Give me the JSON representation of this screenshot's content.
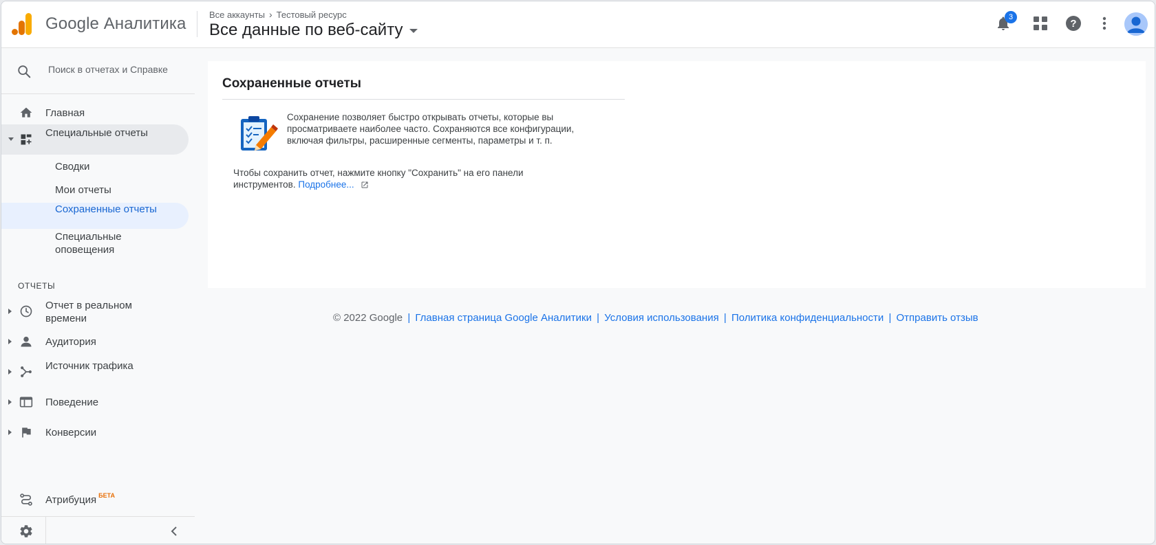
{
  "header": {
    "product_name": "Google Аналитика",
    "breadcrumb": {
      "account": "Все аккаунты",
      "property": "Тестовый ресурс"
    },
    "view_name": "Все данные по веб-сайту",
    "notifications_count": "3",
    "icons": [
      "notifications-icon",
      "apps-grid-icon",
      "help-icon",
      "more-vert-icon",
      "account-avatar-icon"
    ]
  },
  "sidebar": {
    "search_placeholder": "Поиск в отчетах и Справке",
    "items": {
      "home": "Главная",
      "custom_reports": "Специальные отчеты",
      "dashboards": "Сводки",
      "my_reports": "Мои отчеты",
      "saved_reports": "Сохраненные отчеты",
      "custom_alerts": "Специальные оповещения"
    },
    "reports_section_label": "ОТЧЕТЫ",
    "reports": {
      "realtime": "Отчет в реальном времени",
      "audience": "Аудитория",
      "acquisition": "Источник трафика",
      "behavior": "Поведение",
      "conversions": "Конверсии"
    },
    "attribution": "Атрибуция",
    "attribution_badge": "БЕТА"
  },
  "main": {
    "title": "Сохраненные отчеты",
    "description": "Сохранение позволяет быстро открывать отчеты, которые вы просматриваете наиболее часто. Сохраняются все конфигурации, включая фильтры, расширенные сегменты, параметры и т. п.",
    "hint": "Чтобы сохранить отчет, нажмите кнопку \"Сохранить\" на его панели инструментов.",
    "learn_more": "Подробнее..."
  },
  "footer": {
    "copyright": "© 2022 Google",
    "links": {
      "ga_home": "Главная страница Google Аналитики",
      "terms": "Условия использования",
      "privacy": "Политика конфиденциальности",
      "feedback": "Отправить отзыв"
    },
    "separator": "|"
  },
  "colors": {
    "accent": "#1a73e8",
    "logo_orange": "#f9ab00",
    "logo_dark_orange": "#e37400",
    "beta": "#e8710a"
  }
}
